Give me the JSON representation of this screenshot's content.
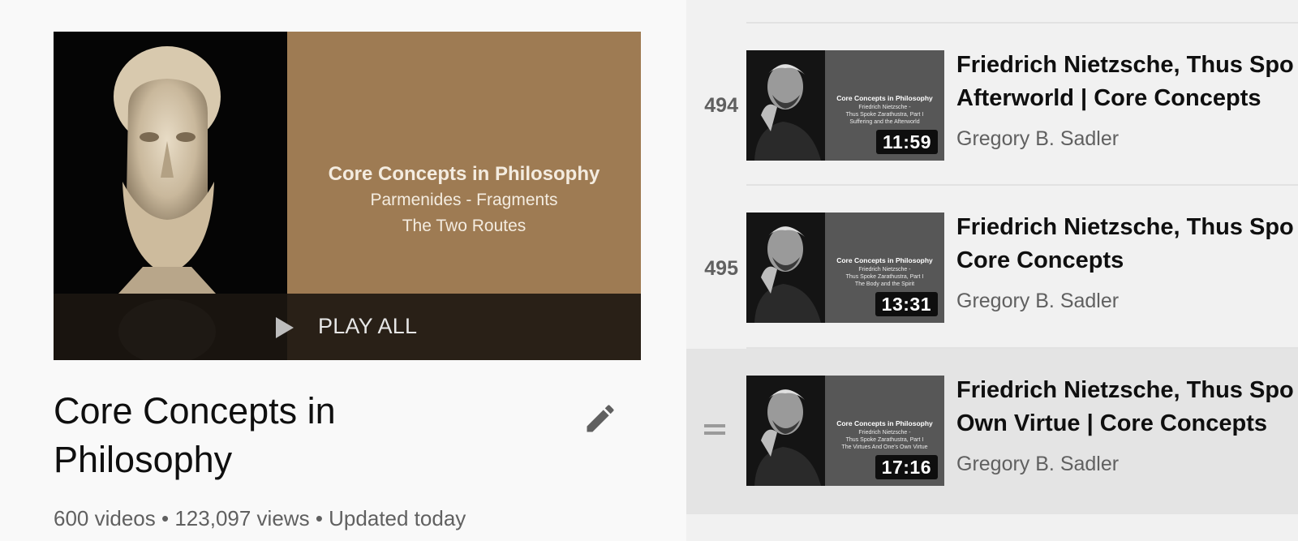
{
  "playlist": {
    "thumbnail": {
      "heading": "Core Concepts in Philosophy",
      "line2": "Parmenides - Fragments",
      "line3": "The Two Routes"
    },
    "play_all_label": "PLAY ALL",
    "title": "Core Concepts in Philosophy",
    "stats": {
      "videos": "600 videos",
      "views": "123,097 views",
      "updated": "Updated today",
      "separator": "•"
    }
  },
  "videos": [
    {
      "index": "494",
      "duration": "11:59",
      "thumb_heading": "Core Concepts in Philosophy",
      "thumb_lines": [
        "Friedrich Nietzsche -",
        "Thus Spoke Zarathustra, Part I",
        "Suffering and the Afterworld"
      ],
      "title_line1": "Friedrich Nietzsche, Thus Spo",
      "title_line2": "Afterworld | Core Concepts",
      "channel": "Gregory B. Sadler"
    },
    {
      "index": "495",
      "duration": "13:31",
      "thumb_heading": "Core Concepts in Philosophy",
      "thumb_lines": [
        "Friedrich Nietzsche -",
        "Thus Spoke Zarathustra, Part I",
        "The Body and the Spirit"
      ],
      "title_line1": "Friedrich Nietzsche, Thus Spo",
      "title_line2": "Core Concepts",
      "channel": "Gregory B. Sadler"
    },
    {
      "index": "",
      "duration": "17:16",
      "thumb_heading": "Core Concepts in Philosophy",
      "thumb_lines": [
        "Friedrich Nietzsche -",
        "Thus Spoke Zarathustra, Part I",
        "The Virtues And One's Own Virtue"
      ],
      "title_line1": "Friedrich Nietzsche, Thus Spo",
      "title_line2": "Own Virtue | Core Concepts",
      "channel": "Gregory B. Sadler",
      "hovered": true
    }
  ],
  "icons": {
    "edit": "pencil-icon",
    "play": "play-icon",
    "drag": "drag-handle-icon"
  },
  "colors": {
    "thumbnail_brown": "#9e7b53",
    "right_panel_bg": "#f1f1f1",
    "hover_row_bg": "#e4e4e4"
  }
}
